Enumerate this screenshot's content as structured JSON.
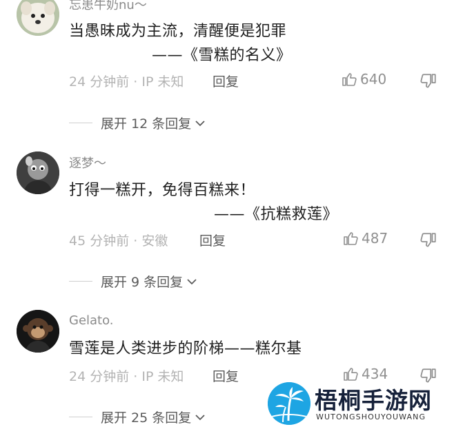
{
  "comments": [
    {
      "username": "忘患牛奶nu～",
      "text": "当愚昧成为主流，清醒便是犯罪",
      "signature": "——《雪糕的名义》",
      "time_location": "24 分钟前 · IP 未知",
      "reply_label": "回复",
      "likes": "640",
      "expand_label": "展开 12 条回复"
    },
    {
      "username": "逐梦～",
      "text": "打得一糕开，免得百糕来！",
      "signature": "——《抗糕救莲》",
      "time_location": "45 分钟前 · 安徽",
      "reply_label": "回复",
      "likes": "487",
      "expand_label": "展开 9 条回复"
    },
    {
      "username": "Gelato.",
      "text": "雪莲是人类进步的阶梯——糕尔基",
      "signature": "",
      "time_location": "24 分钟前 · IP 未知",
      "reply_label": "回复",
      "likes": "434",
      "expand_label": "展开 25 条回复"
    }
  ],
  "watermark": {
    "title": "梧桐手游网",
    "subtitle": "WUTONGSHOUYOUWANG"
  },
  "colors": {
    "text": "#1f1f1f",
    "meta": "#b3b3b3",
    "username": "#8a8a8a",
    "brand": "#1ea5e3"
  },
  "icons": [
    "avatar-dog",
    "avatar-cartoon",
    "avatar-monkey",
    "thumbs-up-icon",
    "thumbs-down-icon",
    "chevron-down-icon",
    "palm-tree-logo"
  ]
}
